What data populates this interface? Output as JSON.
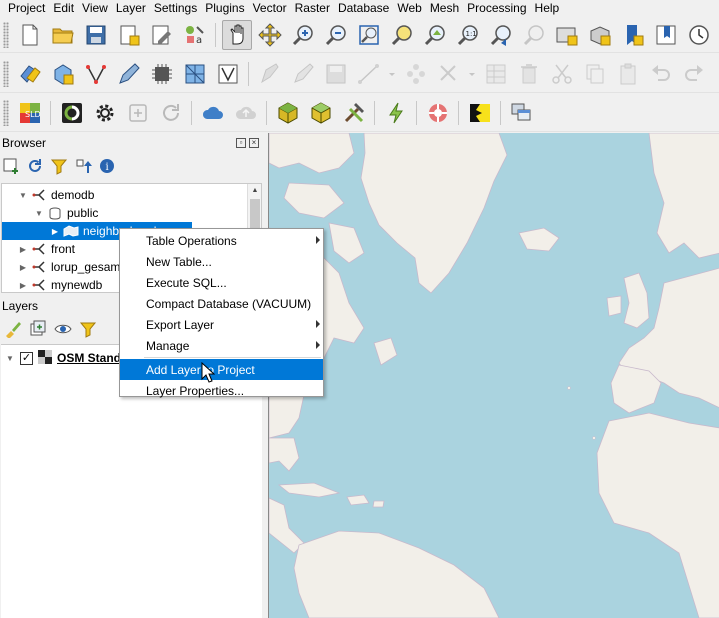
{
  "menubar": [
    "Project",
    "Edit",
    "View",
    "Layer",
    "Settings",
    "Plugins",
    "Vector",
    "Raster",
    "Database",
    "Web",
    "Mesh",
    "Processing",
    "Help"
  ],
  "toolbar1": [
    "new-project-icon",
    "open-project-icon",
    "save-project-icon",
    "print-layout-icon",
    "layout-manager-icon",
    "style-manager-icon",
    "pan-map-icon",
    "pan-to-selection-icon",
    "zoom-in-icon",
    "zoom-out-icon",
    "zoom-full-icon",
    "zoom-to-selection-icon",
    "zoom-to-layer-icon",
    "zoom-native-icon",
    "zoom-last-icon",
    "zoom-next-icon",
    "new-map-view-icon",
    "new-3d-map-view-icon",
    "new-bookmark-icon",
    "show-bookmarks-icon",
    "temporal-controller-icon"
  ],
  "toolbar2": [
    "data-source-manager-icon",
    "new-geopackage-layer-icon",
    "digitize-vertex-icon",
    "digitize-pen-icon",
    "gps-icon",
    "raster-grid-icon",
    "georeferencer-icon",
    "edits-icon",
    "toggle-editing-icon",
    "save-edits-icon",
    "add-line-icon",
    "vertex-tool-icon",
    "modify-attributes-icon",
    "delete-selected-icon",
    "cut-features-icon",
    "copy-features-icon",
    "paste-features-icon",
    "undo-icon",
    "redo-icon"
  ],
  "toolbar3": [
    "sld-icon",
    "qfield-icon",
    "settings-gear-icon",
    "plus-box-icon",
    "refresh-icon",
    "cloud-icon",
    "cloud-upload-icon",
    "cube-green-icon",
    "cube-yellow-icon",
    "hammer-icon",
    "zigzag-icon",
    "lifebuoy-icon",
    "cutout-icon",
    "windows-icon"
  ],
  "browser": {
    "title": "Browser",
    "items": [
      {
        "label": "demodb",
        "level": 1,
        "expanded": true,
        "icon": "postgres-connection-icon"
      },
      {
        "label": "public",
        "level": 2,
        "expanded": true,
        "icon": "schema-icon"
      },
      {
        "label": "neighborhoods",
        "level": 3,
        "expanded": false,
        "icon": "polygon-layer-icon",
        "selected": true
      },
      {
        "label": "front",
        "level": 1,
        "expanded": false,
        "icon": "postgres-connection-icon"
      },
      {
        "label": "lorup_gesamt",
        "level": 1,
        "expanded": false,
        "icon": "postgres-connection-icon"
      },
      {
        "label": "mynewdb",
        "level": 1,
        "expanded": false,
        "icon": "postgres-connection-icon"
      }
    ]
  },
  "layers": {
    "title": "Layers",
    "items": [
      {
        "label": "OSM Standard",
        "checked": true
      }
    ]
  },
  "context_menu": {
    "items": [
      {
        "label": "Table Operations",
        "submenu": true
      },
      {
        "label": "New Table...",
        "submenu": false
      },
      {
        "label": "Execute SQL...",
        "submenu": false
      },
      {
        "label": "Compact Database (VACUUM)",
        "submenu": false
      },
      {
        "label": "Export Layer",
        "submenu": true
      },
      {
        "label": "Manage",
        "submenu": true
      },
      {
        "label": "Add Layer to Project",
        "submenu": false,
        "highlighted": true
      },
      {
        "label": "Layer Properties...",
        "submenu": false
      }
    ]
  },
  "colors": {
    "selection": "#0078d7",
    "water": "#aad3df",
    "land": "#f2efe9"
  }
}
